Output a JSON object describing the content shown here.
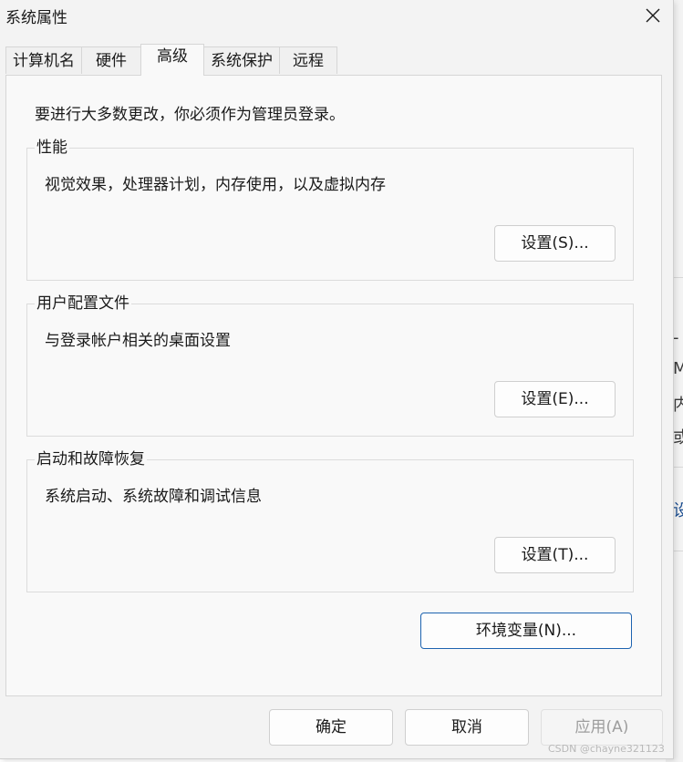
{
  "window": {
    "title": "系统属性"
  },
  "tabs": [
    {
      "label": "计算机名",
      "active": false
    },
    {
      "label": "硬件",
      "active": false
    },
    {
      "label": "高级",
      "active": true
    },
    {
      "label": "系统保护",
      "active": false
    },
    {
      "label": "远程",
      "active": false
    }
  ],
  "advanced": {
    "notice": "要进行大多数更改，你必须作为管理员登录。",
    "groups": [
      {
        "label": "性能",
        "description": "视觉效果，处理器计划，内存使用，以及虚拟内存",
        "button": "设置(S)..."
      },
      {
        "label": "用户配置文件",
        "description": "与登录帐户相关的桌面设置",
        "button": "设置(E)..."
      },
      {
        "label": "启动和故障恢复",
        "description": "系统启动、系统故障和调试信息",
        "button": "设置(T)..."
      }
    ],
    "env_button": "环境变量(N)..."
  },
  "footer": {
    "ok": "确定",
    "cancel": "取消",
    "apply": "应用(A)"
  },
  "background": {
    "fragments": [
      "-",
      "M",
      "内",
      "或",
      "设"
    ]
  },
  "watermark": "CSDN @chayne321123",
  "colors": {
    "window_bg": "#f3f3f3",
    "panel_bg": "#f9f9f9",
    "accent_border": "#1d63b0"
  },
  "icons": {
    "close": "close-icon"
  }
}
